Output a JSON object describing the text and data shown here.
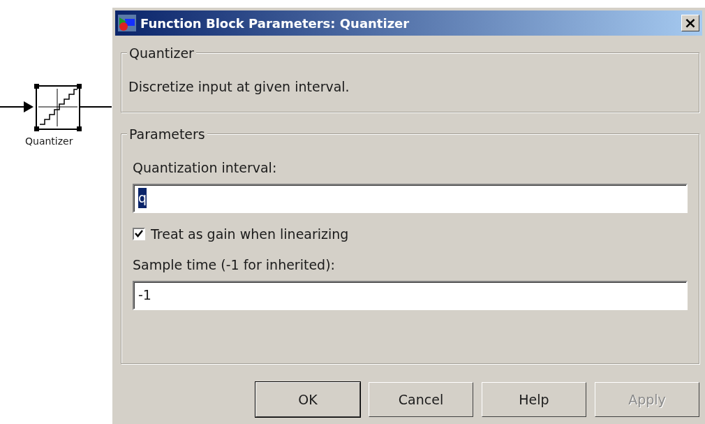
{
  "canvas": {
    "block_label": "Quantizer"
  },
  "window": {
    "title": "Function Block Parameters: Quantizer",
    "close": "×"
  },
  "description_group": {
    "title": "Quantizer",
    "text": "Discretize input at given interval."
  },
  "parameters_group": {
    "title": "Parameters",
    "items": [
      {
        "kind": "field",
        "label": "Quantization interval:",
        "value": "q",
        "value_selected": true
      },
      {
        "kind": "checkbox",
        "label": "Treat as gain when linearizing",
        "checked": true
      },
      {
        "kind": "field",
        "label": "Sample time (-1 for inherited):",
        "value": "-1",
        "value_selected": false
      }
    ]
  },
  "buttons": [
    {
      "label": "OK",
      "disabled": false,
      "default": true
    },
    {
      "label": "Cancel",
      "disabled": false,
      "default": false
    },
    {
      "label": "Help",
      "disabled": false,
      "default": false
    },
    {
      "label": "Apply",
      "disabled": true,
      "default": false
    }
  ]
}
